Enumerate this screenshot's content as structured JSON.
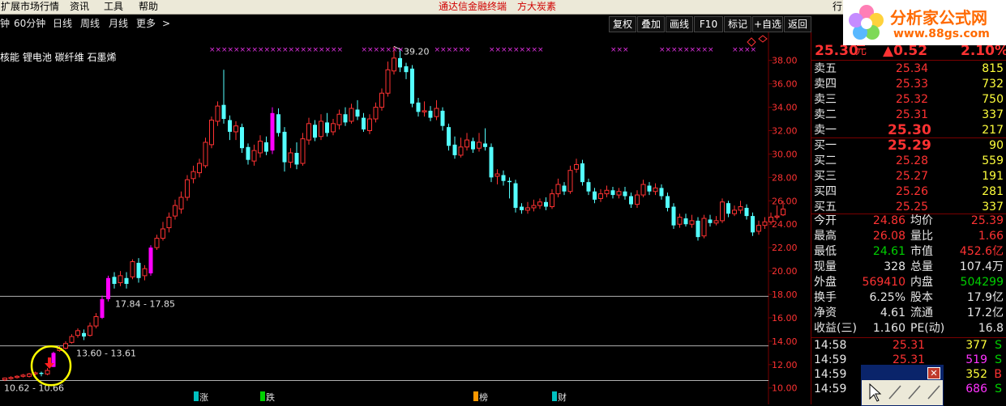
{
  "menu": {
    "items": [
      "扩展市场行情",
      "资讯",
      "工具",
      "帮助"
    ],
    "brand1": "通达信金融终端",
    "brand2": "方大炭素",
    "right_fragment": "行"
  },
  "toolbar": {
    "periods": [
      "钟",
      "60分钟",
      "日线",
      "周线",
      "月线",
      "更多",
      ">"
    ],
    "buttons": [
      "复权",
      "叠加",
      "画线",
      "F10",
      "标记",
      "+自选",
      "返回"
    ]
  },
  "concepts": "核能 锂电池 碳纤维 石墨烯",
  "logo": {
    "title": "分析家公式网",
    "url": "www.88gs.com"
  },
  "quote": {
    "price": "25.30",
    "unit": "元",
    "change": "▲0.52",
    "pct": "2.10%",
    "asks": [
      {
        "label": "卖五",
        "price": "25.34",
        "vol": "815"
      },
      {
        "label": "卖四",
        "price": "25.33",
        "vol": "732"
      },
      {
        "label": "卖三",
        "price": "25.32",
        "vol": "750"
      },
      {
        "label": "卖二",
        "price": "25.31",
        "vol": "337"
      },
      {
        "label": "卖一",
        "price": "25.30",
        "vol": "217"
      }
    ],
    "bids": [
      {
        "label": "买一",
        "price": "25.29",
        "vol": "90"
      },
      {
        "label": "买二",
        "price": "25.28",
        "vol": "559"
      },
      {
        "label": "买三",
        "price": "25.27",
        "vol": "191"
      },
      {
        "label": "买四",
        "price": "25.26",
        "vol": "281"
      },
      {
        "label": "买五",
        "price": "25.25",
        "vol": "337"
      }
    ],
    "stats": [
      {
        "l1": "今开",
        "v1": "24.86",
        "l2": "均价",
        "v2": "25.39"
      },
      {
        "l1": "最高",
        "v1": "26.08",
        "l2": "量比",
        "v2": "1.66"
      },
      {
        "l1": "最低",
        "v1": "24.61",
        "l2": "市值",
        "v2": "452.6亿"
      },
      {
        "l1": "现量",
        "v1": "328",
        "l2": "总量",
        "v2": "107.4万"
      },
      {
        "l1": "外盘",
        "v1": "569410",
        "l2": "内盘",
        "v2": "504299"
      },
      {
        "l1": "换手",
        "v1": "6.25%",
        "l2": "股本",
        "v2": "17.9亿"
      },
      {
        "l1": "净资",
        "v1": "4.61",
        "l2": "流通",
        "v2": "17.2亿"
      },
      {
        "l1": "收益(三)",
        "v1": "1.160",
        "l2": "PE(动)",
        "v2": "16.8"
      }
    ],
    "ticks": [
      {
        "time": "14:58",
        "price": "25.31",
        "vol": "377",
        "side": "S"
      },
      {
        "time": "14:59",
        "price": "25.31",
        "vol": "519",
        "side": "S"
      },
      {
        "time": "14:59",
        "price": "25.30",
        "vol": "352",
        "side": "B"
      },
      {
        "time": "14:59",
        "price": "25.30",
        "vol": "686",
        "side": "S"
      }
    ]
  },
  "colors": {
    "up": "#ff3232",
    "down": "#54ffff",
    "limit_up": "#ff00ff",
    "grid": "#7a0000",
    "axis_text": "#ff3232"
  },
  "chart_data": {
    "type": "candlestick",
    "y_ticks": [
      10.0,
      12.0,
      14.0,
      16.0,
      18.0,
      20.0,
      22.0,
      24.0,
      26.0,
      28.0,
      30.0,
      32.0,
      34.0,
      36.0,
      38.0
    ],
    "y_tick_labels": [
      "10.00",
      "12.00",
      "14.00",
      "16.00",
      "18.00",
      "20.00",
      "22.00",
      "24.00",
      "26.00",
      "28.00",
      "30.00",
      "32.00",
      "34.00",
      "36.00",
      "38.00"
    ],
    "ylim": [
      8.6,
      40.4
    ],
    "high_label": "39.20",
    "price_zones": [
      {
        "label": "10.62 - 10.66",
        "price": 10.64
      },
      {
        "label": "13.60 - 13.61",
        "price": 13.6
      },
      {
        "label": "17.84 - 17.85",
        "price": 17.84
      }
    ],
    "event_markers": [
      "涨",
      "跌",
      "榜",
      "财"
    ],
    "candles": [
      [
        10.7,
        10.85,
        10.9,
        10.6
      ],
      [
        10.8,
        10.9,
        11.0,
        10.7
      ],
      [
        10.9,
        11.0,
        11.1,
        10.8
      ],
      [
        11.0,
        11.1,
        11.2,
        10.9
      ],
      [
        11.0,
        11.2,
        11.3,
        10.9
      ],
      [
        11.2,
        11.3,
        11.4,
        11.1
      ],
      [
        11.3,
        11.2,
        11.4,
        11.0
      ],
      [
        11.2,
        11.5,
        11.7,
        11.1
      ],
      [
        11.8,
        13.0,
        13.1,
        11.8
      ],
      [
        13.2,
        13.4,
        13.6,
        13.1
      ],
      [
        13.4,
        13.8,
        14.0,
        13.3
      ],
      [
        13.9,
        14.4,
        14.6,
        13.8
      ],
      [
        14.5,
        14.9,
        15.1,
        14.3
      ],
      [
        14.7,
        14.4,
        15.0,
        14.1
      ],
      [
        14.5,
        15.3,
        15.6,
        14.4
      ],
      [
        15.3,
        16.1,
        16.4,
        15.1
      ],
      [
        16.0,
        17.6,
        17.9,
        15.9
      ],
      [
        17.6,
        19.4,
        19.6,
        17.4
      ],
      [
        19.5,
        18.9,
        19.9,
        18.5
      ],
      [
        19.0,
        19.6,
        20.0,
        18.7
      ],
      [
        19.4,
        18.9,
        19.9,
        18.5
      ],
      [
        19.5,
        20.8,
        21.0,
        19.3
      ],
      [
        20.7,
        19.4,
        21.1,
        19.0
      ],
      [
        19.6,
        20.2,
        20.5,
        19.2
      ],
      [
        19.8,
        22.0,
        22.2,
        19.6
      ],
      [
        22.0,
        22.8,
        23.1,
        21.8
      ],
      [
        22.8,
        23.6,
        24.2,
        22.6
      ],
      [
        23.7,
        24.6,
        25.0,
        23.3
      ],
      [
        24.7,
        25.6,
        26.1,
        24.4
      ],
      [
        25.3,
        26.3,
        26.8,
        24.9
      ],
      [
        26.3,
        27.8,
        28.2,
        26.0
      ],
      [
        27.9,
        28.5,
        29.0,
        27.5
      ],
      [
        28.4,
        29.2,
        29.6,
        28.0
      ],
      [
        29.0,
        31.0,
        31.4,
        28.8
      ],
      [
        30.8,
        32.9,
        33.2,
        30.5
      ],
      [
        32.8,
        34.1,
        34.5,
        32.4
      ],
      [
        34.2,
        33.0,
        37.2,
        32.6
      ],
      [
        32.9,
        31.9,
        33.3,
        31.2
      ],
      [
        31.9,
        32.4,
        32.8,
        31.2
      ],
      [
        32.3,
        30.5,
        32.6,
        30.1
      ],
      [
        30.6,
        29.5,
        30.9,
        29.1
      ],
      [
        29.4,
        30.3,
        30.8,
        29.0
      ],
      [
        30.1,
        31.1,
        31.6,
        29.7
      ],
      [
        31.0,
        30.2,
        31.5,
        29.9
      ],
      [
        30.3,
        33.5,
        34.0,
        30.0
      ],
      [
        33.4,
        31.8,
        33.9,
        31.5
      ],
      [
        31.9,
        29.3,
        32.3,
        28.5
      ],
      [
        29.3,
        30.1,
        30.5,
        28.8
      ],
      [
        30.1,
        29.1,
        31.0,
        28.7
      ],
      [
        29.2,
        31.3,
        31.8,
        29.0
      ],
      [
        31.2,
        32.6,
        33.1,
        30.8
      ],
      [
        32.5,
        31.4,
        32.9,
        31.1
      ],
      [
        31.5,
        32.8,
        33.4,
        31.2
      ],
      [
        32.7,
        31.8,
        33.5,
        31.5
      ],
      [
        31.9,
        32.6,
        33.0,
        31.6
      ],
      [
        32.5,
        33.4,
        33.8,
        32.1
      ],
      [
        33.4,
        32.7,
        34.0,
        32.4
      ],
      [
        32.8,
        33.9,
        34.3,
        32.6
      ],
      [
        33.8,
        33.2,
        34.6,
        32.9
      ],
      [
        33.1,
        32.1,
        33.5,
        31.9
      ],
      [
        32.0,
        33.0,
        33.4,
        31.7
      ],
      [
        33.0,
        34.0,
        34.4,
        32.7
      ],
      [
        34.0,
        35.2,
        35.6,
        33.7
      ],
      [
        35.2,
        37.2,
        37.9,
        34.9
      ],
      [
        37.1,
        38.2,
        39.2,
        36.8
      ],
      [
        38.2,
        37.4,
        38.9,
        37.0
      ],
      [
        37.5,
        37.0,
        37.8,
        36.4
      ],
      [
        37.3,
        34.3,
        37.6,
        34.0
      ],
      [
        34.4,
        33.6,
        34.8,
        33.2
      ],
      [
        33.6,
        33.7,
        34.5,
        33.2
      ],
      [
        33.7,
        33.1,
        34.1,
        32.8
      ],
      [
        33.2,
        33.9,
        34.6,
        32.9
      ],
      [
        33.7,
        32.4,
        34.0,
        32.0
      ],
      [
        32.3,
        30.7,
        32.6,
        30.3
      ],
      [
        30.8,
        29.9,
        31.5,
        29.6
      ],
      [
        29.9,
        30.6,
        31.4,
        29.7
      ],
      [
        30.6,
        31.2,
        31.8,
        30.3
      ],
      [
        31.1,
        30.4,
        31.4,
        30.1
      ],
      [
        30.5,
        31.0,
        31.8,
        30.2
      ],
      [
        30.9,
        30.6,
        32.2,
        30.3
      ],
      [
        30.6,
        28.0,
        30.9,
        27.6
      ],
      [
        28.1,
        28.3,
        28.7,
        27.4
      ],
      [
        28.2,
        27.7,
        28.6,
        27.3
      ],
      [
        27.7,
        27.6,
        28.0,
        26.2
      ],
      [
        27.5,
        25.4,
        27.8,
        25.0
      ],
      [
        25.5,
        25.2,
        25.8,
        24.9
      ],
      [
        25.2,
        25.4,
        25.9,
        24.9
      ],
      [
        25.4,
        25.6,
        26.1,
        25.1
      ],
      [
        25.6,
        25.9,
        26.2,
        25.3
      ],
      [
        25.9,
        25.5,
        26.3,
        25.2
      ],
      [
        25.5,
        26.6,
        27.0,
        25.3
      ],
      [
        26.6,
        27.4,
        27.9,
        26.3
      ],
      [
        27.3,
        26.8,
        27.6,
        26.5
      ],
      [
        26.8,
        28.6,
        29.0,
        26.6
      ],
      [
        28.7,
        29.1,
        29.6,
        28.4
      ],
      [
        29.2,
        27.6,
        29.5,
        27.3
      ],
      [
        27.6,
        26.8,
        27.9,
        26.5
      ],
      [
        26.8,
        26.1,
        27.1,
        25.8
      ],
      [
        26.2,
        26.6,
        27.0,
        25.9
      ],
      [
        26.6,
        26.9,
        27.3,
        26.3
      ],
      [
        26.9,
        26.5,
        27.2,
        26.2
      ],
      [
        26.5,
        26.8,
        27.1,
        26.2
      ],
      [
        26.8,
        26.4,
        27.2,
        26.1
      ],
      [
        26.4,
        25.7,
        26.7,
        25.4
      ],
      [
        25.7,
        26.5,
        26.9,
        25.4
      ],
      [
        26.5,
        27.4,
        27.8,
        26.3
      ],
      [
        27.3,
        26.8,
        27.6,
        26.5
      ],
      [
        26.8,
        27.1,
        27.5,
        26.5
      ],
      [
        27.1,
        26.4,
        27.4,
        26.1
      ],
      [
        26.4,
        25.4,
        26.7,
        25.1
      ],
      [
        25.5,
        23.9,
        25.8,
        23.6
      ],
      [
        24.0,
        24.6,
        24.9,
        23.7
      ],
      [
        24.5,
        24.0,
        24.9,
        23.8
      ],
      [
        24.0,
        24.3,
        24.8,
        23.7
      ],
      [
        24.3,
        22.9,
        24.6,
        22.6
      ],
      [
        23.0,
        24.5,
        24.8,
        22.8
      ],
      [
        24.4,
        24.1,
        24.8,
        23.8
      ],
      [
        24.1,
        24.3,
        24.7,
        23.9
      ],
      [
        24.3,
        25.9,
        26.2,
        24.1
      ],
      [
        25.8,
        24.9,
        26.0,
        24.6
      ],
      [
        24.9,
        25.2,
        25.6,
        24.7
      ],
      [
        25.2,
        25.5,
        26.0,
        24.9
      ],
      [
        25.4,
        24.7,
        25.7,
        24.4
      ],
      [
        24.7,
        23.3,
        25.0,
        23.0
      ],
      [
        23.4,
        23.9,
        24.3,
        23.1
      ],
      [
        23.9,
        24.2,
        24.6,
        23.6
      ],
      [
        24.2,
        24.6,
        25.0,
        24.0
      ],
      [
        24.6,
        24.7,
        25.6,
        24.4
      ],
      [
        24.8,
        25.3,
        26.0,
        24.7
      ]
    ]
  }
}
